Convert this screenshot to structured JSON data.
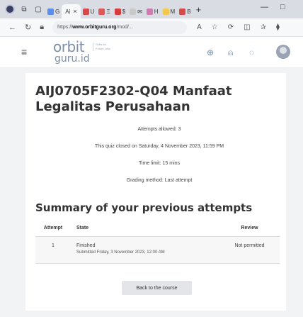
{
  "browser": {
    "tabs": [
      {
        "label": "G",
        "fav_color": "#5b8def"
      },
      {
        "label": "Ai",
        "fav_color": "#7a6fe0",
        "active": true
      },
      {
        "label": "U",
        "fav_color": "#d84a4a"
      },
      {
        "label": "Ξ",
        "fav_color": "#e05757"
      },
      {
        "label": "$",
        "fav_color": "#d83c3c"
      },
      {
        "label": "✉",
        "fav_color": "#c9c9c9"
      },
      {
        "label": "H",
        "fav_color": "#d07bb0"
      },
      {
        "label": "M",
        "fav_color": "#f2c94c"
      },
      {
        "label": "B",
        "fav_color": "#d84a4a"
      }
    ],
    "url_prefix": "https://",
    "url_domain": "www.orbitguru.org",
    "url_rest": "/mod/...",
    "icons": {
      "close": "×",
      "new_tab": "+",
      "minimize": "—",
      "maximize": "□"
    }
  },
  "site": {
    "logo_top": "orbit",
    "logo_bottom": "guru.id",
    "logo_tagline": "Skills for Future Jobs"
  },
  "quiz": {
    "title": "AIJ0705F2302-Q04 Manfaat Legalitas Perusahaan",
    "attempts_allowed": "Attempts allowed: 3",
    "closed": "This quiz closed on Saturday, 4 November 2023, 11:59 PM",
    "time_limit": "Time limit: 15 mins",
    "grading_method": "Grading method: Last attempt"
  },
  "summary": {
    "heading": "Summary of your previous attempts",
    "columns": [
      "Attempt",
      "State",
      "Review"
    ],
    "rows": [
      {
        "attempt": "1",
        "state": "Finished",
        "submitted": "Submitted Friday, 3 November 2023, 12:00 AM",
        "review": "Not permitted"
      }
    ]
  },
  "actions": {
    "back_label": "Back to the course"
  }
}
